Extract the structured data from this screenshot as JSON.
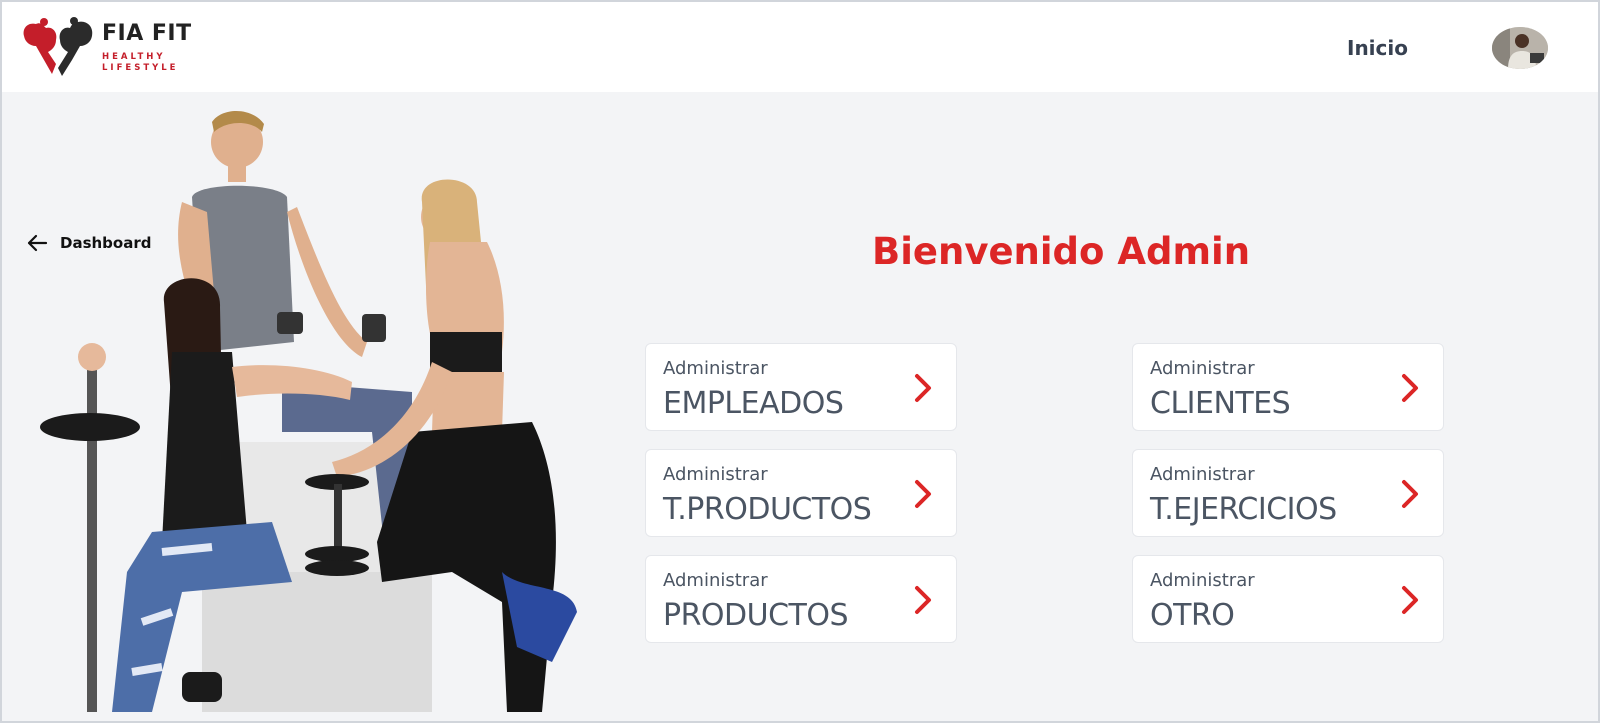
{
  "brand": {
    "name": "FIA FIT",
    "tagline_line1": "HEALTHY",
    "tagline_line2": "LIFESTYLE"
  },
  "nav": {
    "inicio_label": "Inicio"
  },
  "back": {
    "label": "Dashboard"
  },
  "welcome": {
    "title": "Bienvenido Admin"
  },
  "cards": [
    {
      "small": "Administrar",
      "big": "EMPLEADOS"
    },
    {
      "small": "Administrar",
      "big": "CLIENTES"
    },
    {
      "small": "Administrar",
      "big": "T.PRODUCTOS"
    },
    {
      "small": "Administrar",
      "big": "T.EJERCICIOS"
    },
    {
      "small": "Administrar",
      "big": "PRODUCTOS"
    },
    {
      "small": "Administrar",
      "big": "OTRO"
    }
  ],
  "colors": {
    "accent": "#dc2626",
    "text_muted": "#4b5563",
    "background": "#f3f4f6"
  },
  "icons": {
    "back": "arrow-left-icon",
    "card": "chevron-right-icon"
  }
}
